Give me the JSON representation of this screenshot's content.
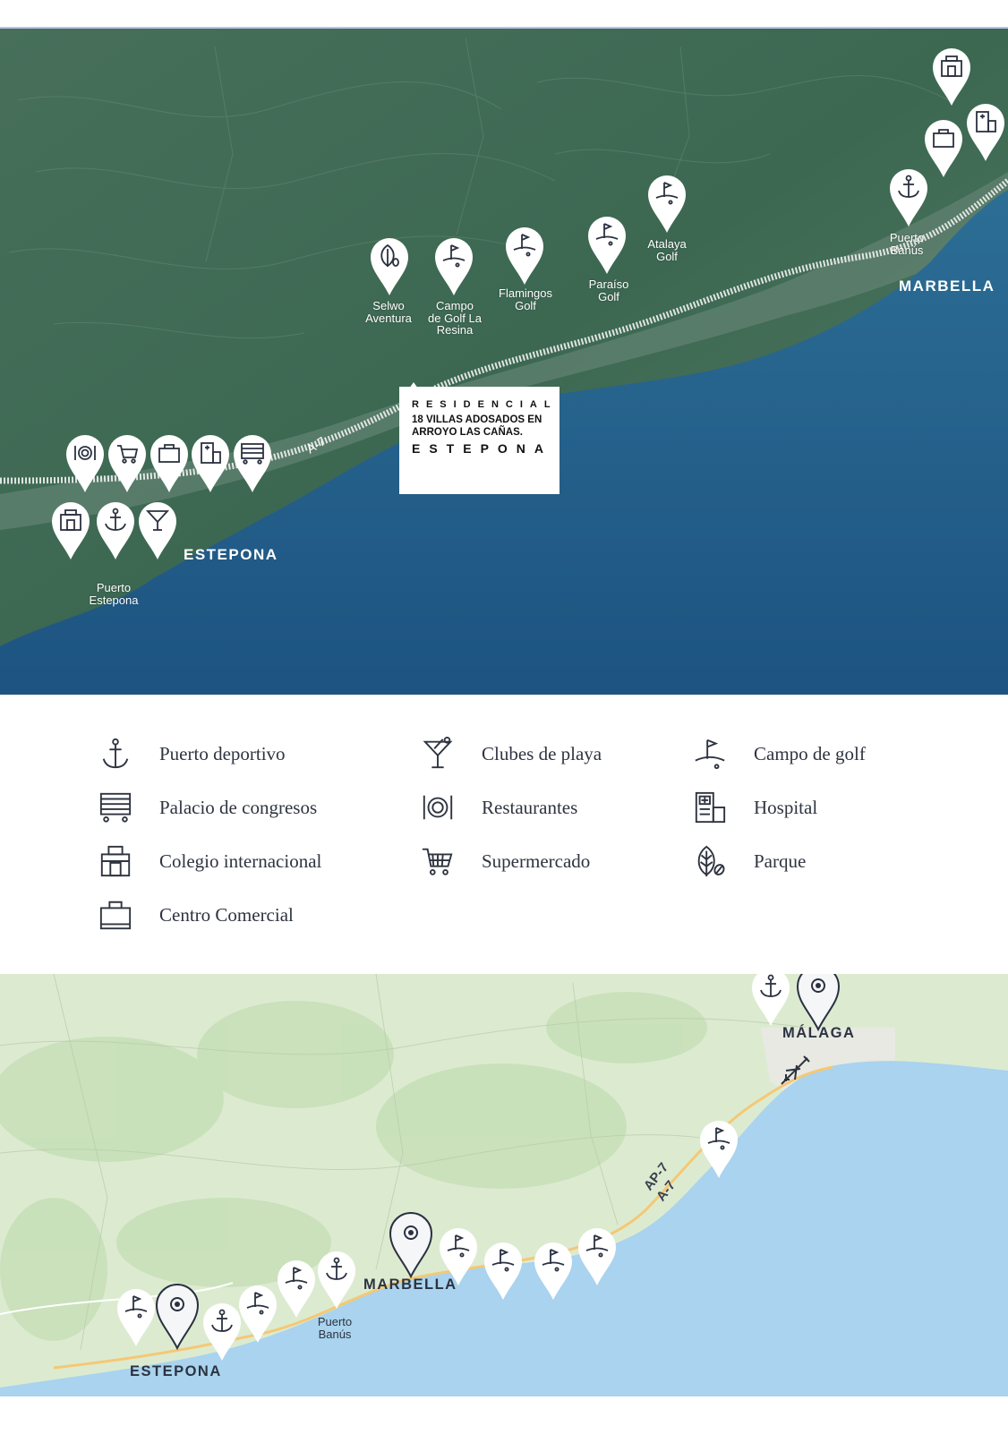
{
  "satellite_map": {
    "road_label": "A-7",
    "cities": {
      "marbella": "MARBELLA",
      "estepona": "ESTEPONA"
    },
    "place_labels": {
      "selwo": "Selwo\nAventura",
      "campo_la_resina": "Campo\nde Golf La\nResina",
      "flamingos": "Flamingos\nGolf",
      "paraiso": "Paraíso\nGolf",
      "atalaya": "Atalaya\nGolf",
      "puerto_banus": "Puerto\nBanús",
      "puerto_estepona": "Puerto\nEstepona"
    },
    "development": {
      "line1": "RESIDENCIAL",
      "line2": "18 VILLAS ADOSADOS EN\nARROYO LAS CAÑAS.",
      "line3": "ESTEPONA"
    },
    "colors": {
      "land": "#3f6b57",
      "sea": "#1f5a86",
      "pin": "#ffffff",
      "pin_icon": "#2b3140"
    }
  },
  "legend": {
    "items": [
      {
        "icon": "anchor-icon",
        "label": "Puerto deportivo"
      },
      {
        "icon": "cocktail-icon",
        "label": "Clubes de playa"
      },
      {
        "icon": "golf-icon",
        "label": "Campo de golf"
      },
      {
        "icon": "congress-hall-icon",
        "label": "Palacio de congresos"
      },
      {
        "icon": "plate-icon",
        "label": "Restaurantes"
      },
      {
        "icon": "hospital-icon",
        "label": "Hospital"
      },
      {
        "icon": "school-icon",
        "label": "Colegio internacional"
      },
      {
        "icon": "cart-icon",
        "label": "Supermercado"
      },
      {
        "icon": "leaf-icon",
        "label": "Parque"
      },
      {
        "icon": "shopping-bag-icon",
        "label": "Centro Comercial"
      }
    ]
  },
  "road_map": {
    "cities": {
      "malaga": "MÁLAGA",
      "marbella": "MARBELLA",
      "estepona": "ESTEPONA"
    },
    "place_labels": {
      "puerto_banus": "Puerto\nBanús"
    },
    "road_labels": {
      "ap7": "AP-7",
      "a7": "A-7"
    },
    "colors": {
      "land": "#dcebd0",
      "sea": "#a9d3ee"
    }
  }
}
